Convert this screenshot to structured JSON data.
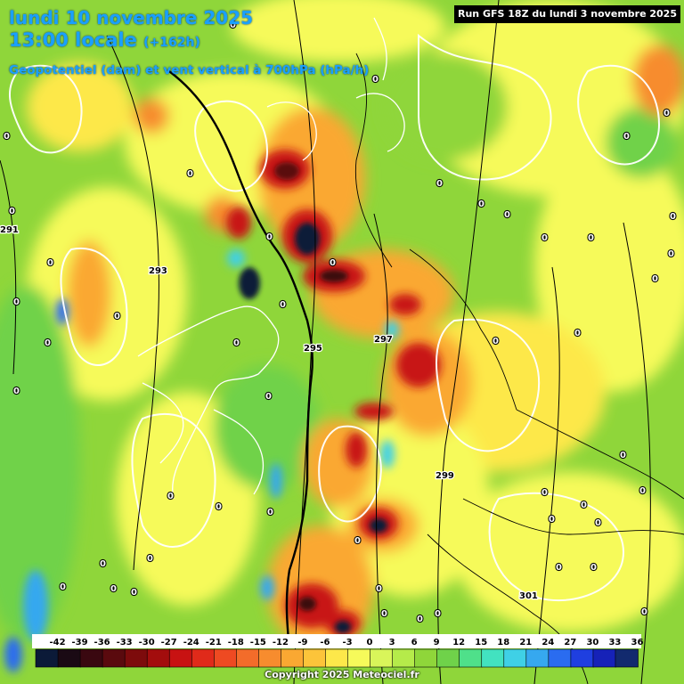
{
  "header": {
    "date_line": "lundi 10 novembre 2025",
    "time_line": "13:00 locale",
    "offset": "(+162h)",
    "parameter": "Geopotentiel (dam) et vent vertical à 700hPa (hPa/h)",
    "run": "Run GFS 18Z du lundi 3 novembre 2025"
  },
  "legend": {
    "ticks": [
      "-42",
      "-39",
      "-36",
      "-33",
      "-30",
      "-27",
      "-24",
      "-21",
      "-18",
      "-15",
      "-12",
      "-9",
      "-6",
      "-3",
      "0",
      "3",
      "6",
      "9",
      "12",
      "15",
      "18",
      "21",
      "24",
      "27",
      "30",
      "33",
      "36"
    ],
    "colors": [
      "#0b1a38",
      "#1a0a14",
      "#3a0810",
      "#5a0a0e",
      "#7d0b0c",
      "#a30d0d",
      "#c81212",
      "#e02a1a",
      "#ee4a22",
      "#f36c2a",
      "#f78c2e",
      "#faa832",
      "#fcc43a",
      "#fde84a",
      "#f6fa5a",
      "#d9f55a",
      "#b5eb4a",
      "#8fd63a",
      "#6fd24a",
      "#4fe08a",
      "#42e2c0",
      "#3fd0e6",
      "#36a8ef",
      "#2a6cf0",
      "#1f3fe0",
      "#1622b8",
      "#122a6e"
    ]
  },
  "geopotential_labels": [
    "291",
    "293",
    "295",
    "297",
    "299",
    "301"
  ],
  "copyright": "Copyright 2025 Meteociel.fr"
}
